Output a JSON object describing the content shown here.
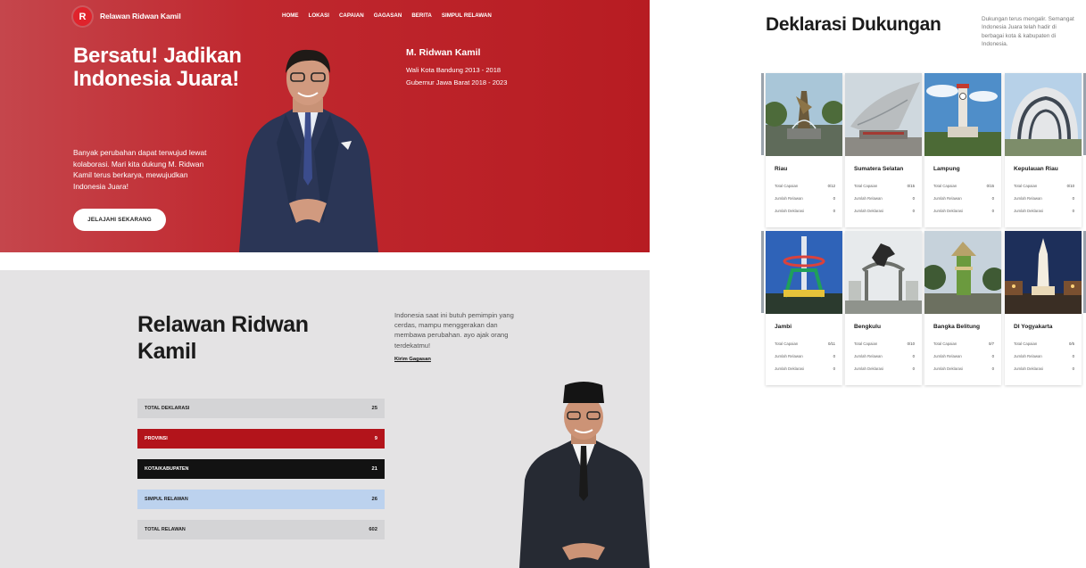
{
  "nav": {
    "logo_letter": "R",
    "brand": "Relawan Ridwan Kamil",
    "items": [
      "HOME",
      "LOKASI",
      "CAPAIAN",
      "GAGASAN",
      "BERITA",
      "SIMPUL RELAWAN"
    ]
  },
  "hero": {
    "title": "Bersatu! Jadikan Indonesia Juara!",
    "description": "Banyak perubahan dapat terwujud lewat kolaborasi. Mari kita dukung M. Ridwan Kamil terus berkarya, mewujudkan Indonesia Juara!",
    "cta": "JELAJAHI SEKARANG",
    "name": "M. Ridwan Kamil",
    "career": [
      "Wali Kota Bandung 2013 - 2018",
      "Gubernur Jawa Barat 2018 - 2023"
    ]
  },
  "stats": {
    "title": "Relawan Ridwan Kamil",
    "intro": "Indonesia saat ini butuh pemimpin yang cerdas, mampu menggerakan dan membawa perubahan. ayo ajak orang terdekatmu!",
    "link": "Kirim Gagasan",
    "rows": [
      {
        "label": "TOTAL DEKLARASI",
        "value": "25",
        "bg": "#d4d4d6",
        "fg": "#1b1b1b"
      },
      {
        "label": "PROVINSI",
        "value": "9",
        "bg": "#b3141b",
        "fg": "#ffffff"
      },
      {
        "label": "KOTA/KABUPATEN",
        "value": "21",
        "bg": "#121212",
        "fg": "#ffffff"
      },
      {
        "label": "SIMPUL RELAWAN",
        "value": "26",
        "bg": "#bcd2ee",
        "fg": "#1b1b1b"
      },
      {
        "label": "TOTAL RELAWAN",
        "value": "602",
        "bg": "#d4d4d6",
        "fg": "#1b1b1b"
      }
    ]
  },
  "deklarasi": {
    "title": "Deklarasi Dukungan",
    "description": "Dukungan terus mengalir. Semangat Indonesia Juara telah hadir di berbagai kota & kabupaten di Indonesia.",
    "labels": {
      "capaian": "Total Capaian",
      "relawan": "Jumlah Relawan",
      "deklarasi": "Jumlah Deklarasi"
    },
    "cards": [
      {
        "province": "Riau",
        "capaian": "0/12",
        "relawan": "0",
        "deklarasi": "0",
        "photo": "statue-fountain"
      },
      {
        "province": "Sumatera Selatan",
        "capaian": "0/15",
        "relawan": "0",
        "deklarasi": "0",
        "photo": "fish-monument"
      },
      {
        "province": "Lampung",
        "capaian": "0/15",
        "relawan": "0",
        "deklarasi": "0",
        "photo": "clock-tower"
      },
      {
        "province": "Kepulauan Riau",
        "capaian": "0/10",
        "relawan": "0",
        "deklarasi": "0",
        "photo": "curved-building"
      },
      {
        "province": "Jambi",
        "capaian": "0/11",
        "relawan": "0",
        "deklarasi": "0",
        "photo": "lit-tower"
      },
      {
        "province": "Bengkulu",
        "capaian": "0/10",
        "relawan": "0",
        "deklarasi": "0",
        "photo": "horse-statue"
      },
      {
        "province": "Bangka Belitung",
        "capaian": "0/7",
        "relawan": "0",
        "deklarasi": "0",
        "photo": "green-tower"
      },
      {
        "province": "DI Yogyakarta",
        "capaian": "0/5",
        "relawan": "0",
        "deklarasi": "0",
        "photo": "tugu-monument"
      }
    ]
  },
  "colors": {
    "brand_red": "#b71c22",
    "accent_blue": "#bcd2ee"
  }
}
